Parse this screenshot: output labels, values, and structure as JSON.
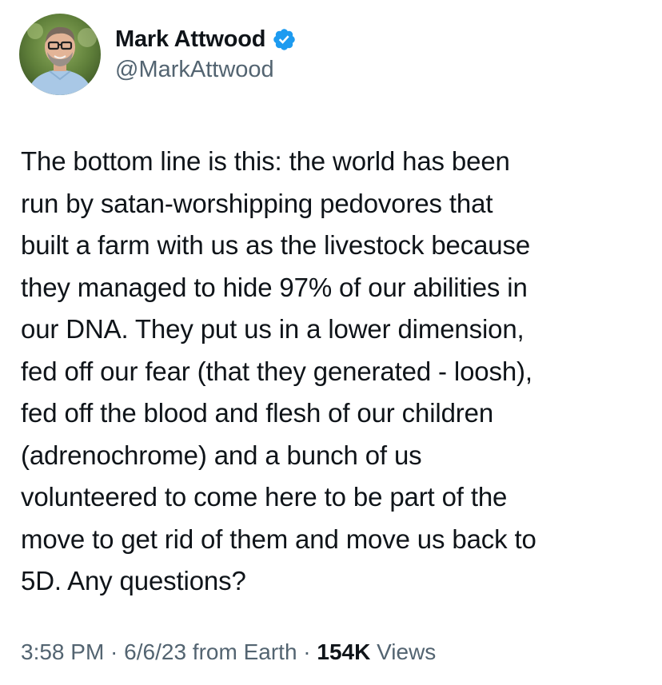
{
  "author": {
    "display_name": "Mark Attwood",
    "handle": "@MarkAttwood",
    "avatar_icon": "profile-photo",
    "verified_icon": "verified-badge-icon",
    "verified_color": "#1d9bf0"
  },
  "tweet": {
    "lines": [
      "The bottom line is this: the world has been",
      "run by satan-worshipping pedovores that",
      "built a farm with us as the livestock because",
      "they managed to hide 97% of our abilities in",
      "our DNA. They put us in a lower dimension,",
      "fed off our fear (that they generated - loosh),",
      "fed off the blood and flesh of our children",
      "(adrenochrome) and a bunch of us",
      "volunteered to come here to be part of the",
      "move to get rid of them and move us back to",
      "5D. Any questions?"
    ]
  },
  "meta": {
    "time": "3:58 PM",
    "separator_1": " · ",
    "date": "6/6/23",
    "source": " from Earth",
    "separator_2": " · ",
    "views_count": "154K",
    "views_label": " Views"
  },
  "colors": {
    "text_primary": "#0f1419",
    "text_secondary": "#536471",
    "verified_blue": "#1d9bf0"
  }
}
